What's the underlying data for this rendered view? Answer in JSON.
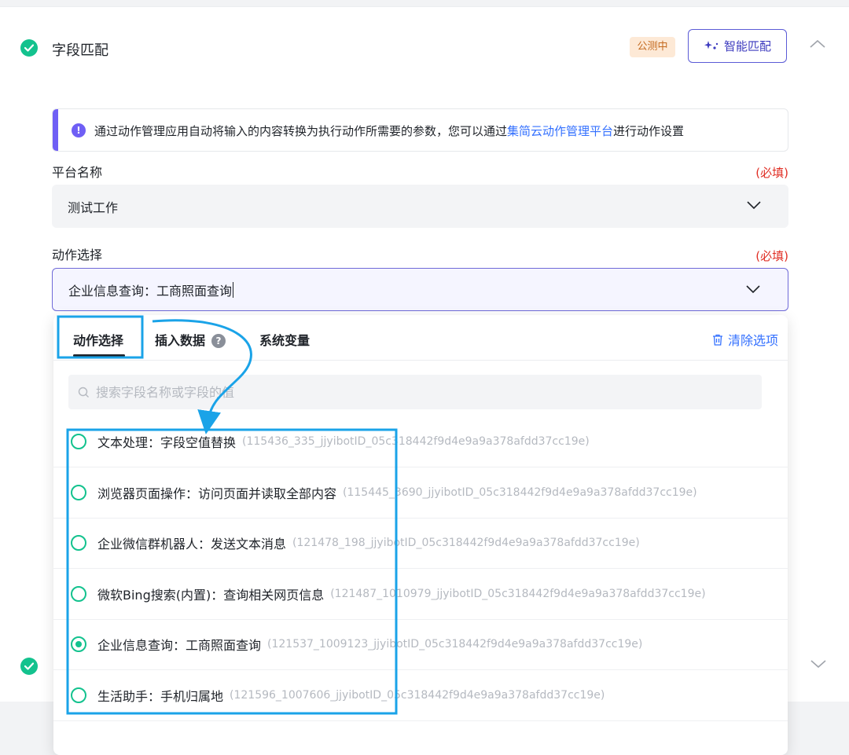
{
  "section": {
    "title": "字段匹配",
    "badge": "公测中",
    "smart_match_label": "智能匹配"
  },
  "info": {
    "text_before": "通过动作管理应用自动将输入的内容转换为执行动作所需要的参数，您可以通过",
    "link": "集简云动作管理平台",
    "text_after": "进行动作设置"
  },
  "platform_field": {
    "label": "平台名称",
    "required": "(必填)",
    "value": "测试工作"
  },
  "action_field": {
    "label": "动作选择",
    "required": "(必填)",
    "value": "企业信息查询：工商照面查询"
  },
  "dropdown": {
    "tabs": [
      "动作选择",
      "插入数据",
      "系统变量"
    ],
    "help_badge": "?",
    "clear_label": "清除选项",
    "search_placeholder": "搜索字段名称或字段的值",
    "options": [
      {
        "name": "文本处理：字段空值替换",
        "id": "(115436_335_jjyibotID_05c318442f9d4e9a9a378afdd37cc19e)",
        "selected": false
      },
      {
        "name": "浏览器页面操作：访问页面并读取全部内容",
        "id": "(115445_3690_jjyibotID_05c318442f9d4e9a9a378afdd37cc19e)",
        "selected": false
      },
      {
        "name": "企业微信群机器人：发送文本消息",
        "id": "(121478_198_jjyibotID_05c318442f9d4e9a9a378afdd37cc19e)",
        "selected": false
      },
      {
        "name": "微软Bing搜索(内置)：查询相关网页信息",
        "id": "(121487_1010979_jjyibotID_05c318442f9d4e9a9a378afdd37cc19e)",
        "selected": false
      },
      {
        "name": "企业信息查询：工商照面查询",
        "id": "(121537_1009123_jjyibotID_05c318442f9d4e9a9a378afdd37cc19e)",
        "selected": true
      },
      {
        "name": "生活助手：手机归属地",
        "id": "(121596_1007606_jjyibotID_05c318442f9d4e9a9a378afdd37cc19e)",
        "selected": false
      }
    ]
  },
  "colors": {
    "accent": "#6f5ff5",
    "success": "#13c28e",
    "link": "#3370ff",
    "required": "#e02e24",
    "annotation": "#1aa3e8"
  }
}
